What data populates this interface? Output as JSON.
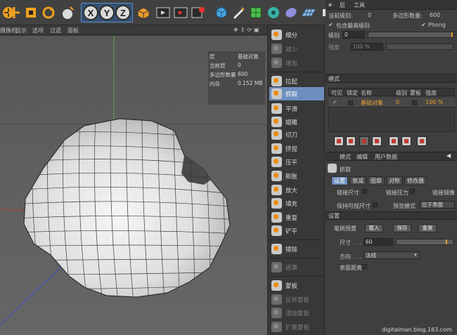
{
  "toolbar": {
    "items": [
      {
        "name": "move-tool-icon"
      },
      {
        "name": "scale-tool-icon"
      },
      {
        "name": "rotate-tool-icon"
      },
      {
        "name": "live-selection-icon"
      },
      {
        "name": "lock-x-button",
        "label": "X"
      },
      {
        "name": "lock-y-button",
        "label": "Y"
      },
      {
        "name": "lock-z-button",
        "label": "Z"
      },
      {
        "name": "coordinate-system-icon"
      },
      {
        "name": "render-view-icon"
      },
      {
        "name": "render-picture-viewer-icon"
      },
      {
        "name": "render-settings-icon"
      },
      {
        "name": "cube-icon"
      },
      {
        "name": "pen-spline-icon"
      },
      {
        "name": "subdivision-surface-icon"
      },
      {
        "name": "cloner-icon"
      },
      {
        "name": "deformer-icon"
      },
      {
        "name": "floor-icon"
      },
      {
        "name": "camera-icon"
      }
    ]
  },
  "viewport": {
    "menu": [
      "摄像机",
      "显示",
      "选项",
      "过滤",
      "面板"
    ],
    "hud": [
      {
        "label": "层",
        "value": "基础对象"
      },
      {
        "label": "当前层",
        "value": "0"
      },
      {
        "label": "多边形数量",
        "value": "600"
      },
      {
        "label": "内存",
        "value": "0.152 MB"
      }
    ]
  },
  "palette": {
    "items": [
      {
        "label": "细分",
        "state": "normal"
      },
      {
        "label": "减少",
        "state": "disabled"
      },
      {
        "label": "增加",
        "state": "disabled"
      },
      {
        "label": "拉起",
        "state": "normal"
      },
      {
        "label": "抓取",
        "state": "selected"
      },
      {
        "label": "平滑",
        "state": "normal"
      },
      {
        "label": "蜡雕",
        "state": "normal"
      },
      {
        "label": "切刀",
        "state": "normal"
      },
      {
        "label": "挤捏",
        "state": "normal"
      },
      {
        "label": "压平",
        "state": "normal"
      },
      {
        "label": "膨胀",
        "state": "normal"
      },
      {
        "label": "放大",
        "state": "normal"
      },
      {
        "label": "填充",
        "state": "normal"
      },
      {
        "label": "重复",
        "state": "normal"
      },
      {
        "label": "铲平",
        "state": "normal"
      },
      {
        "label": "擦除",
        "state": "normal"
      },
      {
        "label": "遮罩",
        "state": "disabled"
      },
      {
        "label": "蒙板",
        "state": "normal"
      },
      {
        "label": "反转蒙板",
        "state": "disabled"
      },
      {
        "label": "清除蒙板",
        "state": "disabled"
      },
      {
        "label": "扩展蒙板",
        "state": "disabled"
      }
    ]
  },
  "layers": {
    "tabs": [
      "层",
      "工具"
    ],
    "current_level_label": "当前级别:",
    "current_level": "0",
    "poly_count_label": "多边形数量:",
    "poly_count": "600",
    "include_top": "包含最高级别",
    "phong": "Phong",
    "level_label": "级别",
    "level_value": "0",
    "strength_label": "强度",
    "strength_value": "100 %",
    "mode_label": "模式",
    "columns": [
      "可见",
      "锁定",
      "名称",
      "级别",
      "蒙板",
      "强度"
    ],
    "row": {
      "name": "基础对象",
      "level": "0",
      "strength": "100 %"
    }
  },
  "attributes": {
    "menu": [
      "模式",
      "编辑",
      "用户数据"
    ],
    "tool_title": "抓取",
    "tabs": [
      "设置",
      "衰减",
      "图章",
      "对称",
      "修改器"
    ],
    "link_size": "链接尺寸",
    "link_pressure": "链接压力",
    "link_mirror": "链接镜像",
    "keep_visible_size": "保持可视尺寸",
    "preview_mode_label": "预览模式",
    "preview_mode_value": "位于表面",
    "settings_header": "设置",
    "brush_preset_label": "笔刷预置",
    "load_btn": "载入",
    "save_btn": "保存",
    "reset_btn": "重置",
    "size_label": "尺寸 . . .",
    "size_value": "60",
    "direction_label": "方向 . . .",
    "direction_value": "法线",
    "surface_distance": "表面距离"
  },
  "watermark": "digitalman.blog.163.com",
  "colors": {
    "accent": "#6d8fbf",
    "orange": "#f0a030",
    "panel": "#3f3f3f"
  }
}
